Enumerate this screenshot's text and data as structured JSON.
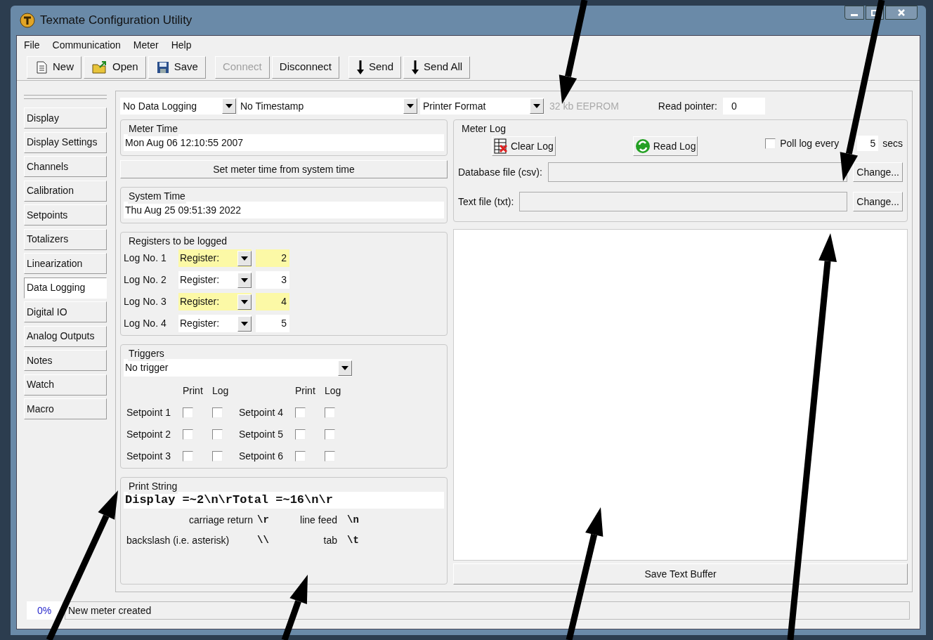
{
  "window": {
    "title": "Texmate Configuration Utility"
  },
  "menu": [
    {
      "label": "File"
    },
    {
      "label": "Communication"
    },
    {
      "label": "Meter"
    },
    {
      "label": "Help"
    }
  ],
  "toolbar": [
    {
      "label": "New",
      "kind": "new",
      "disabled": false
    },
    {
      "label": "Open",
      "kind": "open",
      "disabled": false
    },
    {
      "label": "Save",
      "kind": "save",
      "disabled": false
    },
    {
      "label": "Connect",
      "kind": "plain",
      "disabled": true
    },
    {
      "label": "Disconnect",
      "kind": "plain",
      "disabled": false
    },
    {
      "label": "Send",
      "kind": "send",
      "disabled": false
    },
    {
      "label": "Send All",
      "kind": "send",
      "disabled": false
    }
  ],
  "sidebar": {
    "items": [
      {
        "label": "Display",
        "selected": false
      },
      {
        "label": "Display Settings",
        "selected": false
      },
      {
        "label": "Channels",
        "selected": false
      },
      {
        "label": "Calibration",
        "selected": false
      },
      {
        "label": "Setpoints",
        "selected": false
      },
      {
        "label": "Totalizers",
        "selected": false
      },
      {
        "label": "Linearization",
        "selected": false
      },
      {
        "label": "Data Logging",
        "selected": true
      },
      {
        "label": "Digital IO",
        "selected": false
      },
      {
        "label": "Analog Outputs",
        "selected": false
      },
      {
        "label": "Notes",
        "selected": false
      },
      {
        "label": "Watch",
        "selected": false
      },
      {
        "label": "Macro",
        "selected": false
      }
    ]
  },
  "options": {
    "logging_mode": "No Data Logging",
    "timestamp": "No Timestamp",
    "format": "Printer Format",
    "memory": "32 kb EEPROM",
    "read_pointer_label": "Read pointer:",
    "read_pointer": "0"
  },
  "meter_time": {
    "title": "Meter Time",
    "value": "Mon Aug 06 12:10:55 2007"
  },
  "set_time_button": "Set meter time from system time",
  "system_time": {
    "title": "System Time",
    "value": "Thu Aug 25 09:51:39 2022"
  },
  "registers": {
    "title": "Registers to be logged",
    "rows": [
      {
        "label": "Log No. 1",
        "register": "Register:",
        "value": "2",
        "highlighted": true
      },
      {
        "label": "Log No. 2",
        "register": "Register:",
        "value": "3",
        "highlighted": false
      },
      {
        "label": "Log No. 3",
        "register": "Register:",
        "value": "4",
        "highlighted": true
      },
      {
        "label": "Log No. 4",
        "register": "Register:",
        "value": "5",
        "highlighted": false
      }
    ]
  },
  "triggers": {
    "title": "Triggers",
    "selection": "No trigger",
    "headers": [
      "Print",
      "Log",
      "Print",
      "Log"
    ],
    "setpoints": [
      {
        "label": "Setpoint 1",
        "print": false,
        "log": false
      },
      {
        "label": "Setpoint 4",
        "print": false,
        "log": false
      },
      {
        "label": "Setpoint 2",
        "print": false,
        "log": false
      },
      {
        "label": "Setpoint 5",
        "print": false,
        "log": false
      },
      {
        "label": "Setpoint 3",
        "print": false,
        "log": false
      },
      {
        "label": "Setpoint 6",
        "print": false,
        "log": false
      }
    ]
  },
  "print_string": {
    "title": "Print String",
    "value": "Display =~2\\n\\rTotal =~16\\n\\r",
    "legend": [
      {
        "label": "carriage return",
        "code": "\\r"
      },
      {
        "label": "line feed",
        "code": "\\n"
      },
      {
        "label": "backslash (i.e. asterisk)",
        "code": "\\\\"
      },
      {
        "label": "tab",
        "code": "\\t"
      }
    ]
  },
  "meter_log": {
    "title": "Meter Log",
    "clear_button": "Clear Log",
    "read_button": "Read Log",
    "poll": {
      "label": "Poll log every",
      "checked": false,
      "value": "5",
      "unit": "secs"
    },
    "database": {
      "label": "Database file (csv):",
      "button": "Change..."
    },
    "text_file": {
      "label": "Text file (txt):",
      "button": "Change..."
    }
  },
  "text_buffer_button": "Save Text Buffer",
  "status_bar": {
    "progress": "0%",
    "message": "New meter created"
  }
}
